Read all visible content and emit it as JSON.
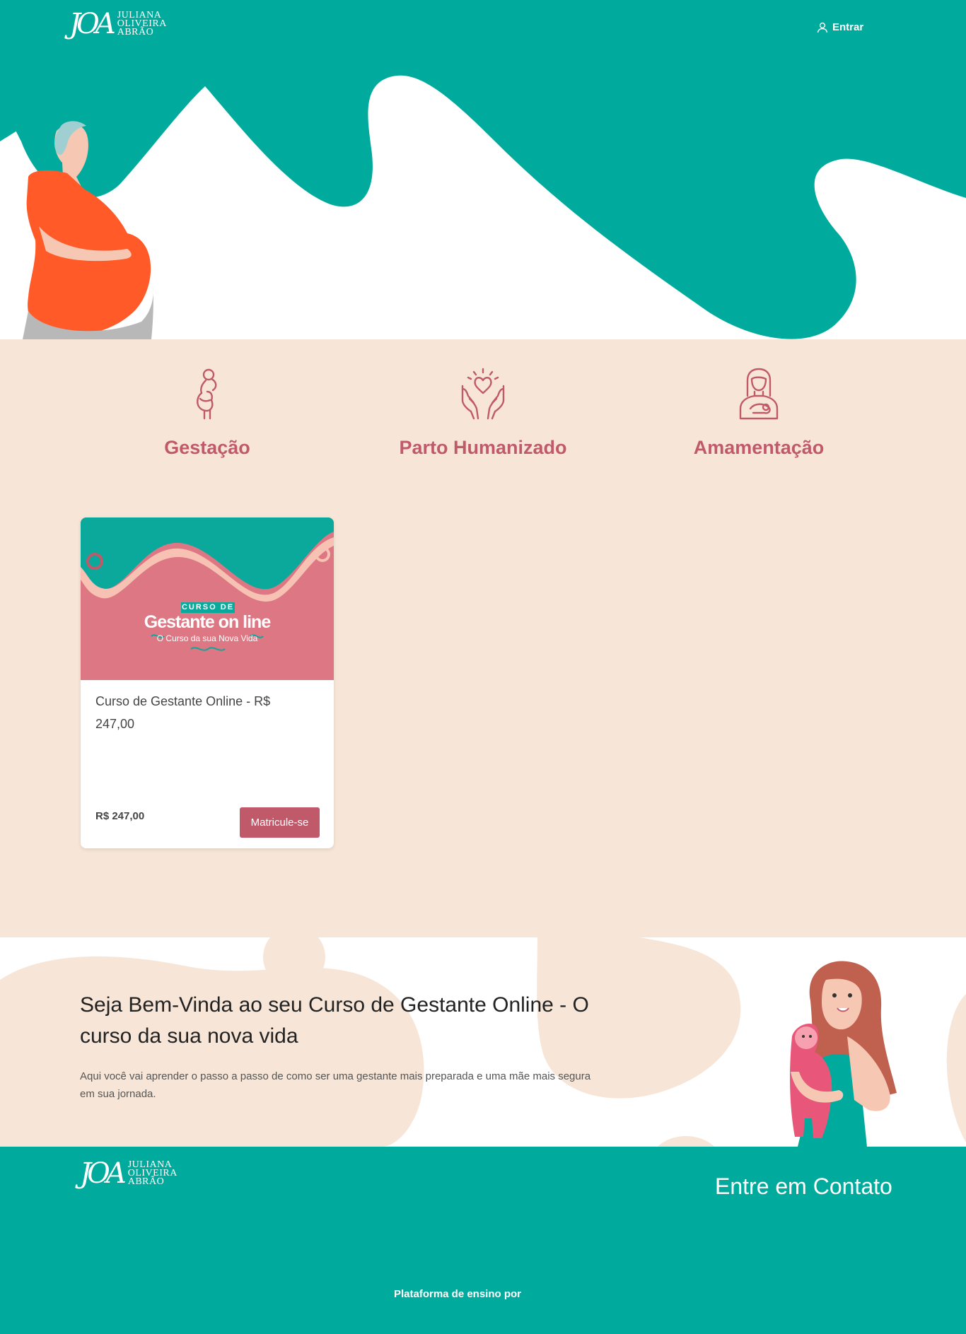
{
  "brand": {
    "monogram": "JOA",
    "name_lines": [
      "JULIANA",
      "OLIVEIRA",
      "ABRÃO"
    ]
  },
  "header": {
    "login_label": "Entrar",
    "login_icon": "user-icon"
  },
  "features": [
    {
      "title": "Gestação",
      "icon": "pregnant-woman-icon"
    },
    {
      "title": "Parto Humanizado",
      "icon": "hands-heart-icon"
    },
    {
      "title": "Amamentação",
      "icon": "breastfeeding-icon"
    }
  ],
  "course": {
    "thumb_badge": "CURSO DE",
    "thumb_title": "Gestante on line",
    "thumb_subtitle": "O Curso da sua Nova Vida",
    "title": "Curso de Gestante Online - R$ 247,00",
    "price": "R$ 247,00",
    "enroll_label": "Matricule-se"
  },
  "welcome": {
    "title": "Seja Bem-Vinda ao seu Curso de Gestante Online - O curso da sua nova vida",
    "text": "Aqui você vai aprender o passo a passo de como ser uma gestante mais preparada e uma mãe mais segura em sua jornada."
  },
  "footer": {
    "contact_label": "Entre em Contato",
    "credit": "Plataforma de ensino por"
  },
  "colors": {
    "teal": "#00ab9d",
    "beige": "#f7e6d7",
    "rose": "#c05a6a",
    "orange": "#ff5a28"
  }
}
